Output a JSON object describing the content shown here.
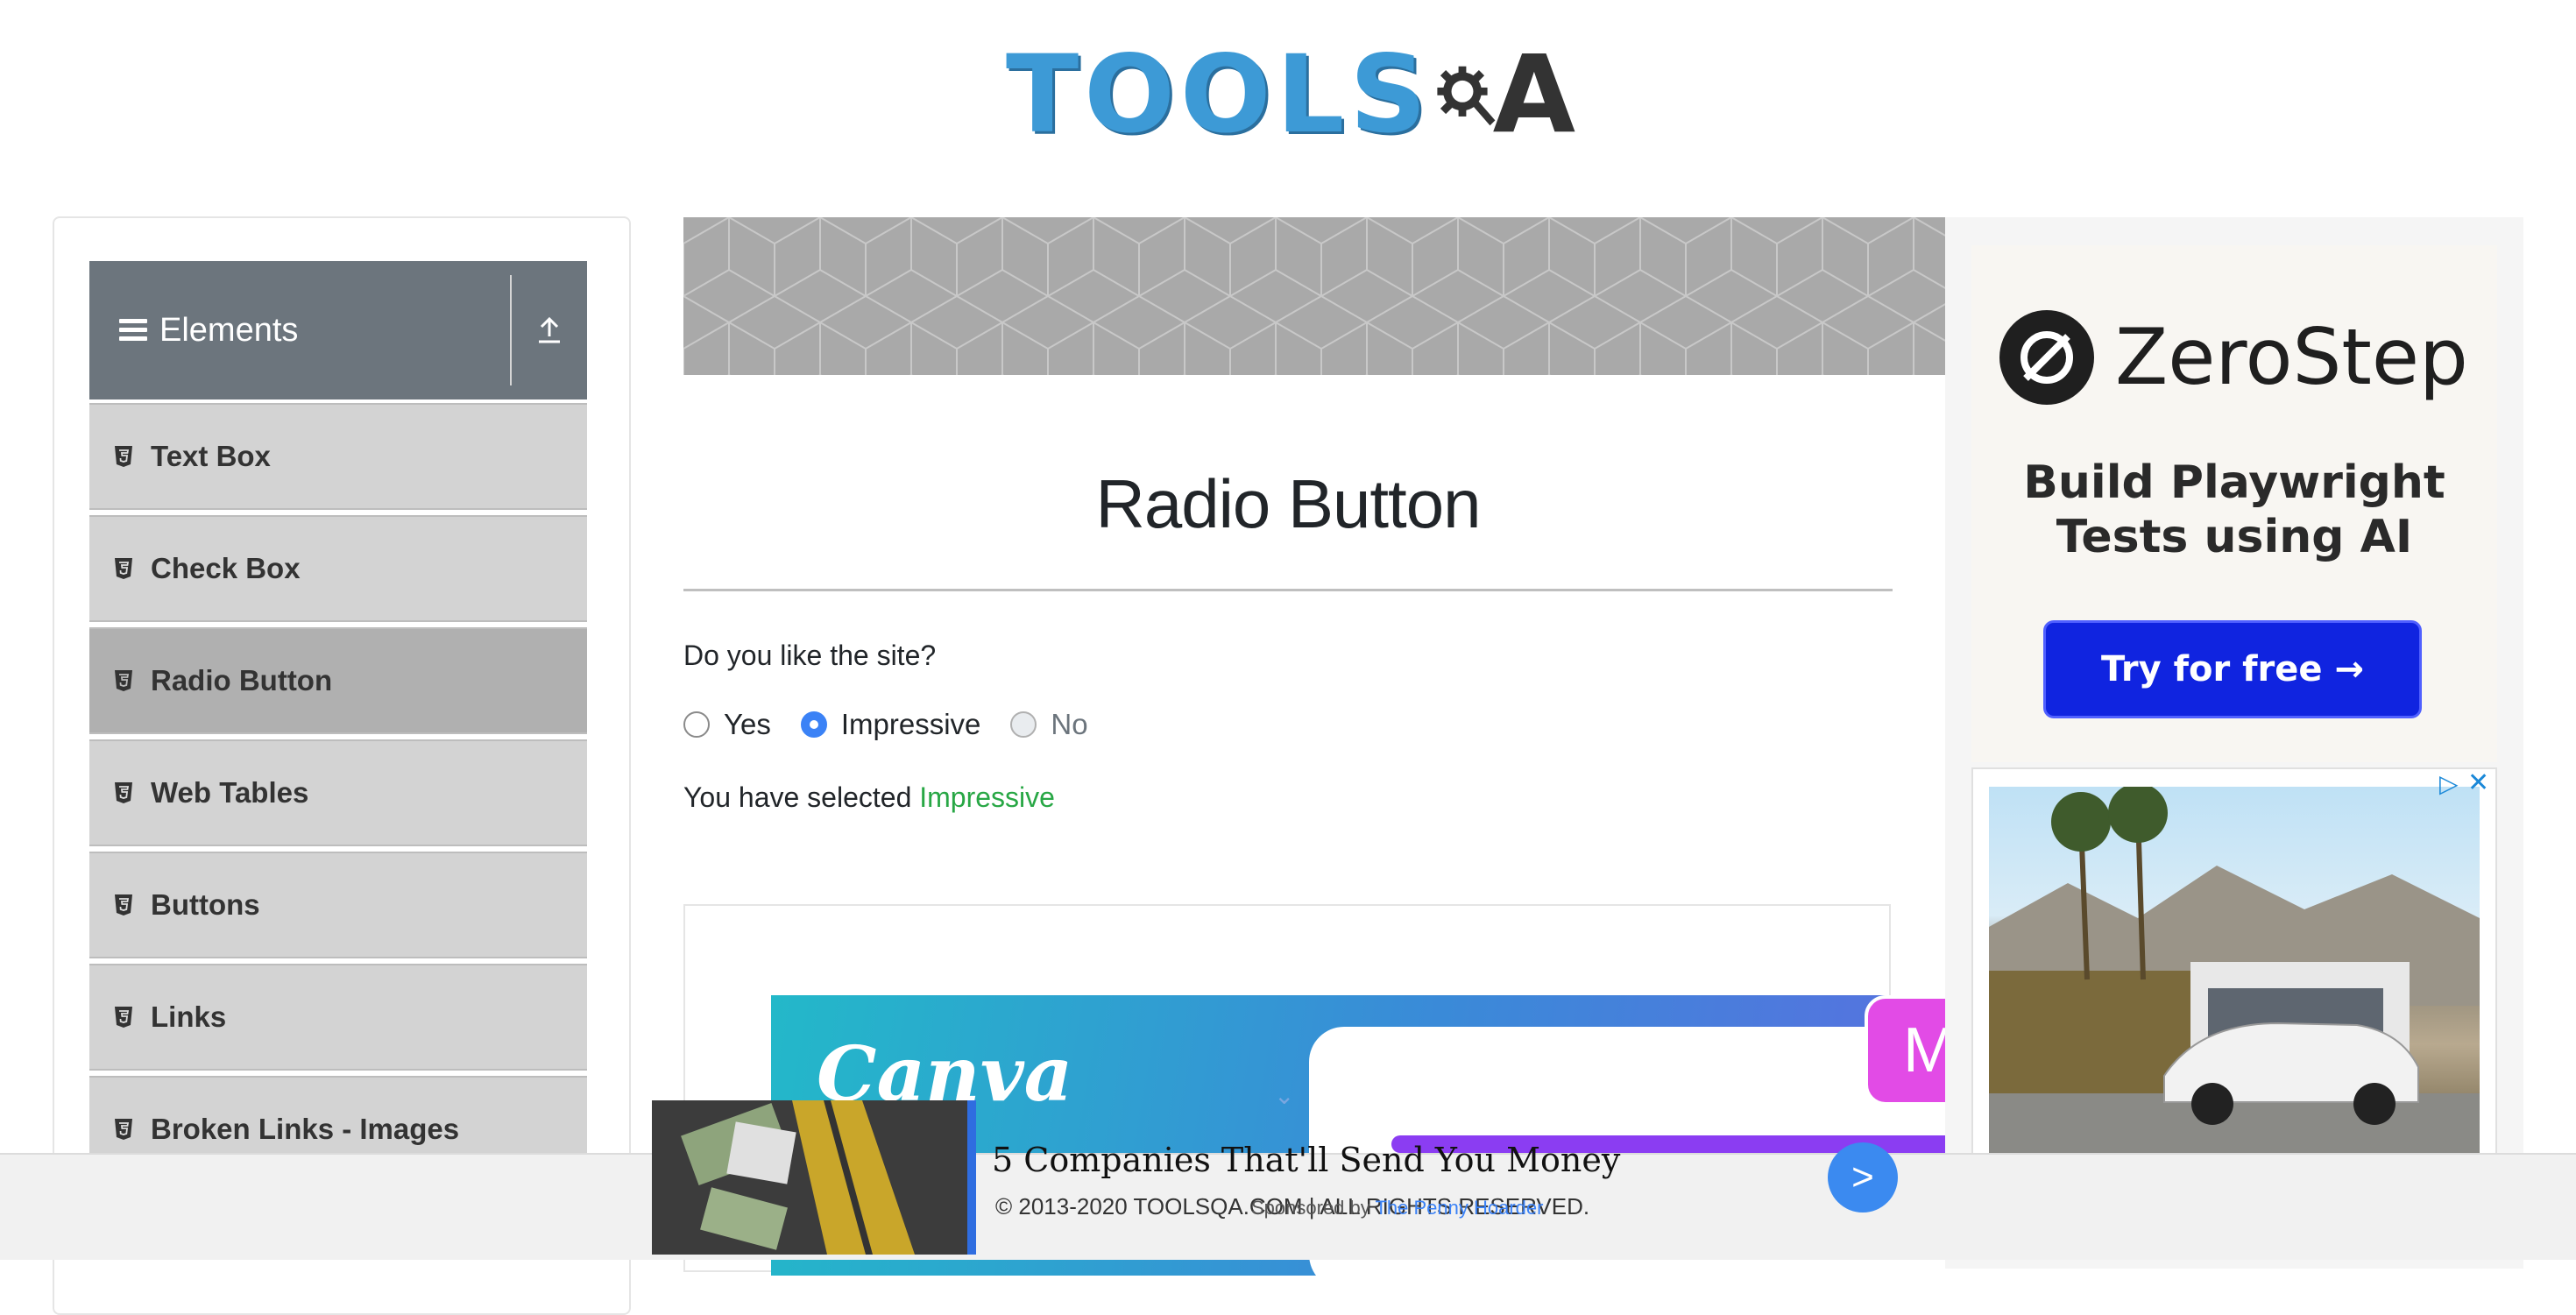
{
  "header": {
    "logo_part_blue": "TOOLS",
    "logo_part_dark": "A"
  },
  "sidebar": {
    "group_title": "Elements",
    "items": [
      {
        "label": "Text Box"
      },
      {
        "label": "Check Box"
      },
      {
        "label": "Radio Button",
        "active": true
      },
      {
        "label": "Web Tables"
      },
      {
        "label": "Buttons"
      },
      {
        "label": "Links"
      },
      {
        "label": "Broken Links - Images"
      }
    ]
  },
  "main": {
    "title": "Radio Button",
    "question": "Do you like the site?",
    "options": [
      {
        "label": "Yes",
        "checked": false,
        "disabled": false
      },
      {
        "label": "Impressive",
        "checked": true,
        "disabled": false
      },
      {
        "label": "No",
        "checked": false,
        "disabled": true
      }
    ],
    "result_prefix": "You have selected",
    "result_value": "Impressive"
  },
  "ads": {
    "canva_logo": "Canva",
    "canva_badge": "M",
    "zerostep_name": "ZeroStep",
    "zerostep_tagline_line1": "Build Playwright",
    "zerostep_tagline_line2": "Tests using AI",
    "zerostep_button": "Try for free →",
    "bottom_headline": "5 Companies That'll Send You Money",
    "bottom_sponsor_prefix": "Sponsored by",
    "bottom_sponsor_brand": "The Penny Hoarder",
    "bottom_arrow": ">"
  },
  "footer": {
    "copyright": "© 2013-2020 TOOLSQA.COM | ALL RIGHTS RESERVED."
  },
  "colors": {
    "success": "#28a745",
    "sidebar_header": "#6c757d",
    "logo_blue": "#3d9ad6",
    "zerostep_button": "#1024e0"
  }
}
